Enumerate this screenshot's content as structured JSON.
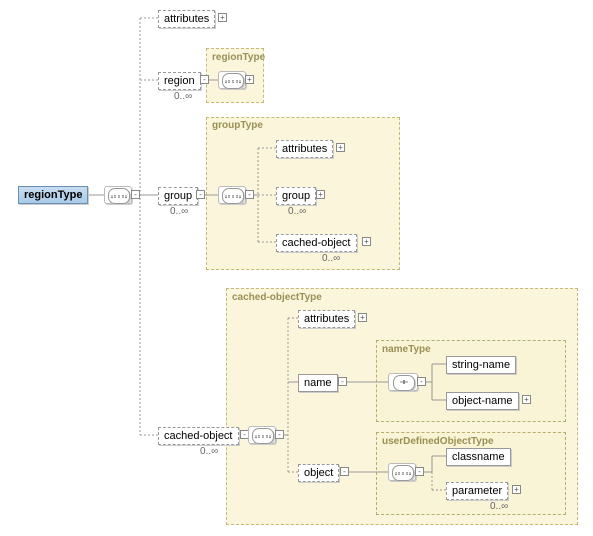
{
  "root": {
    "label": "regionType"
  },
  "level1": {
    "attributes": {
      "label": "attributes",
      "card": ""
    },
    "region": {
      "label": "region",
      "card": "0..∞",
      "type": "regionType"
    },
    "group": {
      "label": "group",
      "card": "0..∞",
      "type": "groupType"
    },
    "cachedObject": {
      "label": "cached-object",
      "card": "0..∞",
      "type": "cached-objectType"
    }
  },
  "groupType": {
    "attributes": {
      "label": "attributes"
    },
    "group": {
      "label": "group",
      "card": "0..∞"
    },
    "cachedObject": {
      "label": "cached-object",
      "card": "0..∞"
    }
  },
  "cachedObjectType": {
    "attributes": {
      "label": "attributes"
    },
    "name": {
      "label": "name",
      "type": "nameType",
      "stringName": {
        "label": "string-name"
      },
      "objectName": {
        "label": "object-name"
      }
    },
    "object": {
      "label": "object",
      "type": "userDefinedObjectType",
      "classname": {
        "label": "classname"
      },
      "parameter": {
        "label": "parameter",
        "card": "0..∞"
      }
    }
  }
}
